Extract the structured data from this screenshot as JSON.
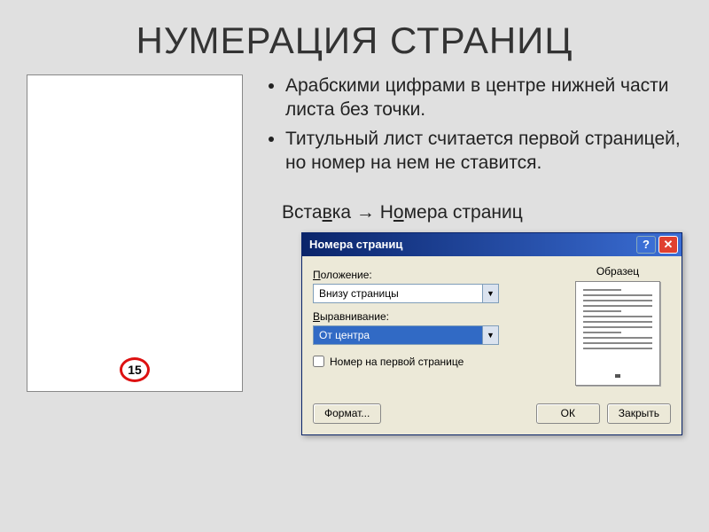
{
  "title": "НУМЕРАЦИЯ СТРАНИЦ",
  "page_example": {
    "number": "15"
  },
  "bullets": [
    "Арабскими цифрами в центре нижней части листа без точки.",
    "Титульный лист считается первой страницей, но номер на нем не ставится."
  ],
  "menu_path": {
    "left": "Вставка",
    "arrow": "→",
    "right": "Номера страниц",
    "u1": "в",
    "u2": "о"
  },
  "dialog": {
    "title": "Номера страниц",
    "position_label": "Положение:",
    "position_value": "Внизу страницы",
    "align_label": "Выравнивание:",
    "align_value": "От центра",
    "checkbox_label": "Номер на первой странице",
    "preview_label": "Образец",
    "format_btn": "Формат...",
    "ok_btn": "ОК",
    "close_btn": "Закрыть"
  }
}
